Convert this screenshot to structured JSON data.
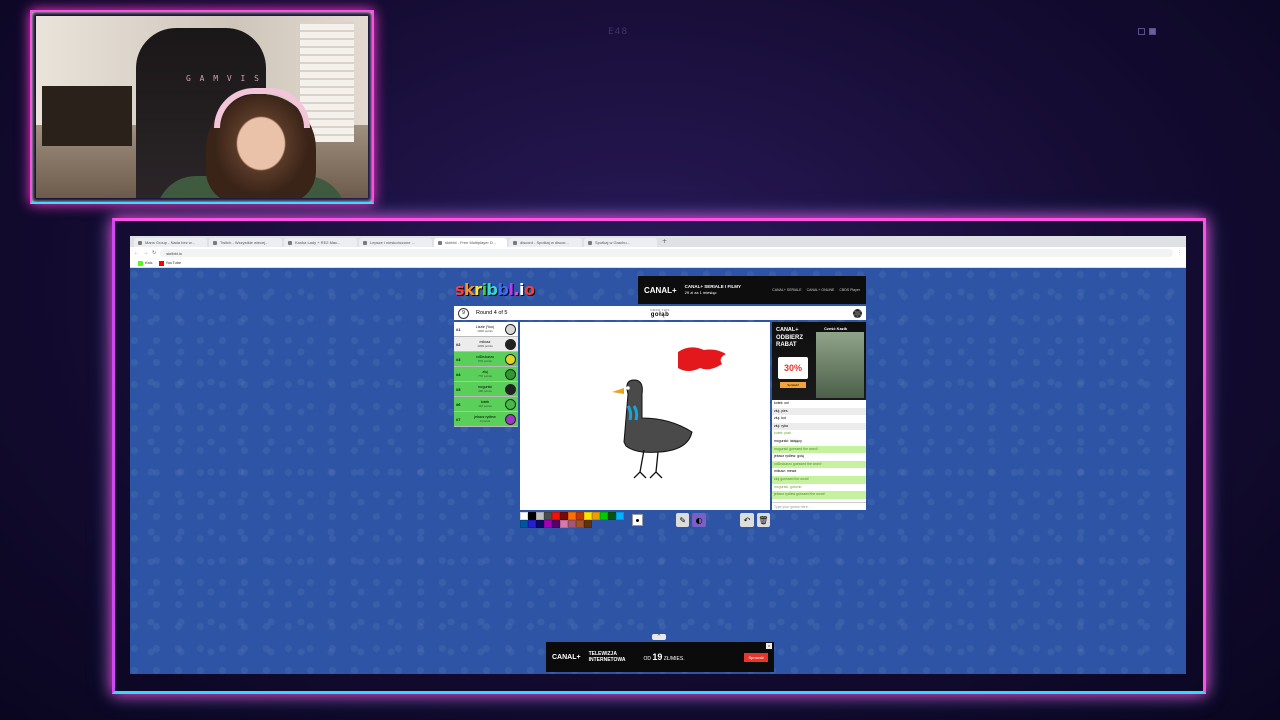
{
  "overlay": {
    "top_label": "E48"
  },
  "webcam": {
    "chair_brand": "G A M V I S"
  },
  "browser": {
    "tabs": [
      {
        "label": "Mans Group - Nada bez w...",
        "active": false
      },
      {
        "label": "Twitch - Wszystkie wiecej...",
        "active": false
      },
      {
        "label": "Kanka Lady + RE2 Mac...",
        "active": false
      },
      {
        "label": "Lepsze i nieskończone ...",
        "active": false
      },
      {
        "label": "skribbl - Free Multiplayer D...",
        "active": true
      },
      {
        "label": "discord - Spotkaj w discor...",
        "active": false
      },
      {
        "label": "Spotkaj w Grachu...",
        "active": false
      }
    ],
    "url": "skribbl.io",
    "bookmarks": [
      "Kick",
      "YouTube"
    ]
  },
  "game": {
    "logo": "skribbl.io",
    "logo_colors": [
      "#ff3b3b",
      "#ff8f1f",
      "#ffe62e",
      "#3bd43b",
      "#3bd4d4",
      "#3b6bff",
      "#b13bff",
      "#ff3bd0",
      "#ffffff",
      "#ff3b3b"
    ],
    "timer": "9",
    "round_text": "Round 4 of 5",
    "word_label": "DRAW THIS",
    "word": "gołąb",
    "players": [
      {
        "rank": "#1",
        "name": "Lizzie (You)",
        "points": "1300 points",
        "style": "white",
        "avatar": "#d8d8d8"
      },
      {
        "rank": "#2",
        "name": "mikusz",
        "points": "1309 points",
        "style": "grey",
        "avatar": "#222222"
      },
      {
        "rank": "#3",
        "name": "xdDrukarzu",
        "points": "870 points",
        "style": "green",
        "avatar": "#e0d42a"
      },
      {
        "rank": "#4",
        "name": "złuj",
        "points": "770 points",
        "style": "green",
        "avatar": "#2e9a2e"
      },
      {
        "rank": "#5",
        "name": "mcgurski",
        "points": "490 points",
        "style": "green",
        "avatar": "#222222"
      },
      {
        "rank": "#6",
        "name": "kotek",
        "points": "410 points",
        "style": "green",
        "avatar": "#44bb44"
      },
      {
        "rank": "#7",
        "name": "jebacz rydlew",
        "points": "0 points",
        "style": "green",
        "avatar": "#9a3bc2"
      }
    ],
    "chat": {
      "ad": {
        "brand": "CANAL+",
        "headline_1": "ODBIERZ",
        "headline_2": "RABAT",
        "percent": "30%",
        "cta": "Sprawdź",
        "photo_title": "Cześć Kazik"
      },
      "messages": [
        {
          "text": "kotek: onl",
          "kind": "plain"
        },
        {
          "text": "złuj: pies",
          "kind": "odd"
        },
        {
          "text": "złuj: kot",
          "kind": "plain"
        },
        {
          "text": "złuj: ryba",
          "kind": "odd"
        },
        {
          "text": "kotek: ptak",
          "kind": "sys"
        },
        {
          "text": "mcgurski: latający",
          "kind": "plain"
        },
        {
          "text": "mcgurski guessed the word!",
          "kind": "guess"
        },
        {
          "text": "jebacz rydlew: gołą",
          "kind": "plain"
        },
        {
          "text": "xdDrukarzu guessed the word!",
          "kind": "guess"
        },
        {
          "text": "mikusz: mewa",
          "kind": "plain"
        },
        {
          "text": "złuj guessed the word!",
          "kind": "guess"
        },
        {
          "text": "mcgurski: gołomb",
          "kind": "sys"
        },
        {
          "text": "jebacz rydlew guessed the word!",
          "kind": "guess"
        }
      ],
      "input_placeholder": "Type your guess here..."
    },
    "palette": [
      "#ffffff",
      "#000000",
      "#c1c1c1",
      "#4c4c4c",
      "#ef130b",
      "#740b07",
      "#ff7100",
      "#c23800",
      "#ffe400",
      "#e8a200",
      "#00cc00",
      "#005510",
      "#00b2ff",
      "#00569e",
      "#231fd3",
      "#0e0865",
      "#a300ba",
      "#550069",
      "#d37caa",
      "#a75574",
      "#a0522d",
      "#63300d"
    ]
  },
  "ads": {
    "top": {
      "brand": "CANAL+",
      "line1": "CANAL+ SERIALE I FILMY",
      "line2": "29 zł za 1 miesiąc",
      "logos": [
        "CANAL+ SERIALE",
        "CANAL+ ONLINE",
        "CBDS Player"
      ]
    },
    "bottom": {
      "brand": "CANAL+",
      "line1": "TELEWIZJA",
      "line2": "INTERNETOWA",
      "price_prefix": "OD",
      "price": "19",
      "price_suffix": "ZŁ/MIES.",
      "cta": "Sprawdź",
      "close": "x"
    },
    "scroll_hint": "^"
  }
}
